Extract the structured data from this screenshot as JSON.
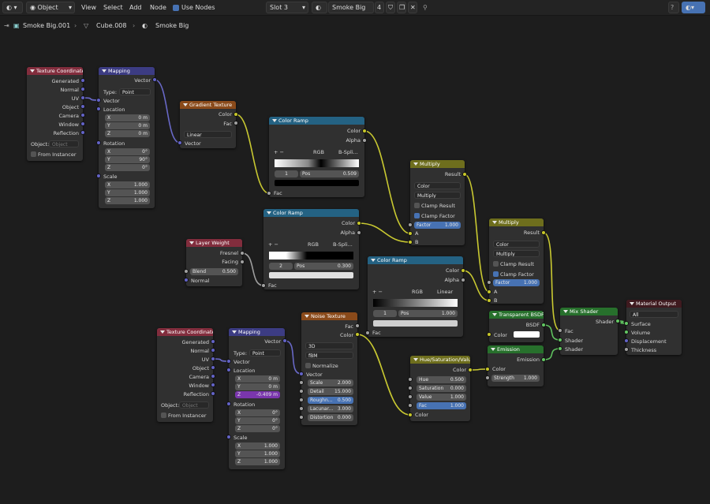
{
  "topbar": {
    "mode": "Object",
    "menus": [
      "View",
      "Select",
      "Add",
      "Node"
    ],
    "use_nodes": "Use Nodes",
    "slot": "Slot 3",
    "material": "Smoke Big",
    "users": "4"
  },
  "breadcrumbs": [
    "Smoke Big.001",
    "Cube.008",
    "Smoke Big"
  ],
  "colors": {
    "wire_color": "#c9c931",
    "wire_float": "#9e9e9e",
    "wire_vector": "#6868c6",
    "wire_shader": "#5fc25f"
  },
  "nodes": {
    "texcoord1": {
      "title": "Texture Coordinate",
      "outputs": [
        "Generated",
        "Normal",
        "UV",
        "Object",
        "Camera",
        "Window",
        "Reflection"
      ],
      "object_label": "Object:",
      "object_placeholder": "Object",
      "from_instancer": "From Instancer"
    },
    "mapping1": {
      "title": "Mapping",
      "out": "Vector",
      "type_label": "Type:",
      "type": "Point",
      "vector": "Vector",
      "location": "Location",
      "loc": [
        "0 m",
        "0 m",
        "0 m"
      ],
      "rotation": "Rotation",
      "rot": [
        "0°",
        "90°",
        "0°"
      ],
      "scale": "Scale",
      "scl": [
        "1.000",
        "1.000",
        "1.000"
      ],
      "axes": [
        "X",
        "Y",
        "Z"
      ]
    },
    "gradient": {
      "title": "Gradient Texture",
      "outputs": [
        "Color",
        "Fac"
      ],
      "mode": "Linear",
      "input": "Vector"
    },
    "ramp1": {
      "title": "Color Ramp",
      "outputs": [
        "Color",
        "Alpha"
      ],
      "ops": "+ −",
      "mode": "RGB",
      "interp": "B-Spli...",
      "index": "1",
      "pos_label": "Pos",
      "pos": "0.509",
      "input": "Fac"
    },
    "multiply1": {
      "title": "Multiply",
      "out": "Result",
      "dtype": "Color",
      "op": "Multiply",
      "clamp_result": "Clamp Result",
      "clamp_factor": "Clamp Factor",
      "factor_label": "Factor",
      "factor": "1.000",
      "inputs": [
        "A",
        "B"
      ]
    },
    "ramp2": {
      "title": "Color Ramp",
      "outputs": [
        "Color",
        "Alpha"
      ],
      "ops": "+ −",
      "mode": "RGB",
      "interp": "B-Spli...",
      "index": "2",
      "pos_label": "Pos",
      "pos": "0.300",
      "input": "Fac"
    },
    "layerweight": {
      "title": "Layer Weight",
      "outputs": [
        "Fresnel",
        "Facing"
      ],
      "blend_label": "Blend",
      "blend": "0.500",
      "normal": "Normal"
    },
    "multiply2": {
      "title": "Multiply",
      "out": "Result",
      "dtype": "Color",
      "op": "Multiply",
      "clamp_result": "Clamp Result",
      "clamp_factor": "Clamp Factor",
      "factor_label": "Factor",
      "factor": "1.000",
      "inputs": [
        "A",
        "B"
      ]
    },
    "ramp3": {
      "title": "Color Ramp",
      "outputs": [
        "Color",
        "Alpha"
      ],
      "ops": "+ −",
      "mode": "RGB",
      "interp": "Linear",
      "index": "1",
      "pos_label": "Pos",
      "pos": "1.000",
      "input": "Fac"
    },
    "transparent": {
      "title": "Transparent BSDF",
      "out": "BSDF",
      "color": "Color"
    },
    "emission": {
      "title": "Emission",
      "out": "Emission",
      "color": "Color",
      "strength_label": "Strength",
      "strength": "1.000"
    },
    "mix": {
      "title": "Mix Shader",
      "out": "Shader",
      "inputs": [
        "Fac",
        "Shader",
        "Shader"
      ]
    },
    "output": {
      "title": "Material Output",
      "target": "All",
      "inputs": [
        "Surface",
        "Volume",
        "Displacement",
        "Thickness"
      ]
    },
    "texcoord2": {
      "title": "Texture Coordinate",
      "outputs": [
        "Generated",
        "Normal",
        "UV",
        "Object",
        "Camera",
        "Window",
        "Reflection"
      ],
      "object_label": "Object:",
      "object_placeholder": "Object",
      "from_instancer": "From Instancer"
    },
    "mapping2": {
      "title": "Mapping",
      "out": "Vector",
      "type_label": "Type:",
      "type": "Point",
      "vector": "Vector",
      "location": "Location",
      "loc": [
        "0 m",
        "0 m",
        "-0.409 m"
      ],
      "rotation": "Rotation",
      "rot": [
        "0°",
        "0°",
        "0°"
      ],
      "scale": "Scale",
      "scl": [
        "1.000",
        "1.000",
        "1.000"
      ],
      "axes": [
        "X",
        "Y",
        "Z"
      ]
    },
    "noise": {
      "title": "Noise Texture",
      "outputs": [
        "Fac",
        "Color"
      ],
      "dims": "3D",
      "ntype": "fBM",
      "normalize": "Normalize",
      "vector": "Vector",
      "fields": [
        [
          "Scale",
          "2.000"
        ],
        [
          "Detail",
          "15.000"
        ],
        [
          "Roughn...",
          "0.500"
        ],
        [
          "Lacunar...",
          "3.000"
        ],
        [
          "Distortion",
          "0.000"
        ]
      ]
    },
    "huesat": {
      "title": "Hue/Saturation/Value",
      "out": "Color",
      "fields": [
        [
          "Hue",
          "0.500"
        ],
        [
          "Saturation",
          "0.000"
        ],
        [
          "Value",
          "1.000"
        ],
        [
          "Fac",
          "1.000"
        ]
      ],
      "color": "Color"
    }
  }
}
